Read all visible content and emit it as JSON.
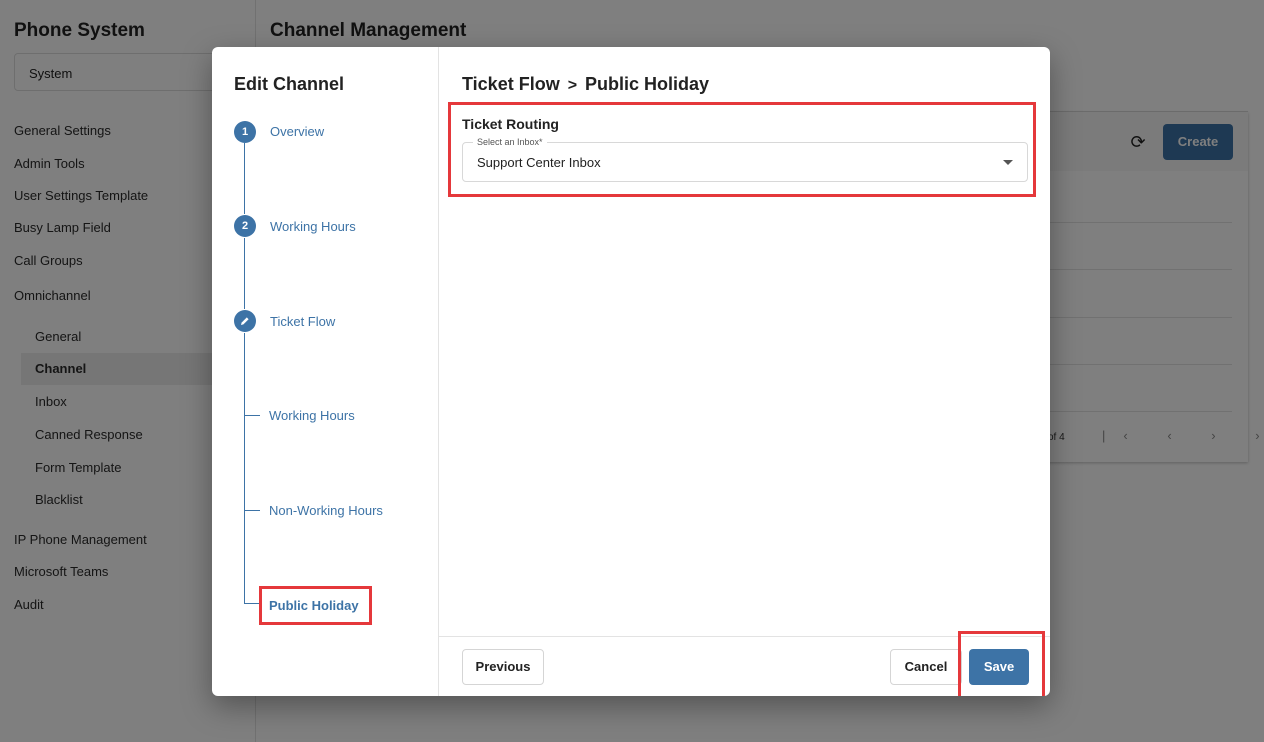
{
  "background": {
    "sidebar": {
      "title": "Phone System",
      "system_select": "System",
      "items": [
        {
          "label": "General Settings"
        },
        {
          "label": "Admin Tools"
        },
        {
          "label": "User Settings Template"
        },
        {
          "label": "Busy Lamp Field"
        },
        {
          "label": "Call Groups"
        },
        {
          "label": "Omnichannel"
        }
      ],
      "omnichannel_sub": [
        {
          "label": "General"
        },
        {
          "label": "Channel"
        },
        {
          "label": "Inbox"
        },
        {
          "label": "Canned Response"
        },
        {
          "label": "Form Template"
        },
        {
          "label": "Blacklist"
        }
      ],
      "items_after": [
        {
          "label": "IP Phone Management"
        },
        {
          "label": "Microsoft Teams"
        },
        {
          "label": "Audit"
        }
      ]
    },
    "main": {
      "title": "Channel Management",
      "create_label": "Create",
      "refresh_icon": "refresh-icon",
      "pager_text": "of 4",
      "pager_icons": "|‹ ‹ › ›|"
    }
  },
  "modal": {
    "title": "Edit Channel",
    "steps": [
      {
        "number": "1",
        "label": "Overview"
      },
      {
        "number": "2",
        "label": "Working Hours"
      },
      {
        "number": "",
        "icon": "pencil-icon",
        "label": "Ticket Flow"
      }
    ],
    "substeps": [
      {
        "label": "Working Hours"
      },
      {
        "label": "Non-Working Hours"
      },
      {
        "label": "Public Holiday"
      }
    ],
    "breadcrumb": {
      "parent": "Ticket Flow",
      "separator": ">",
      "current": "Public Holiday"
    },
    "section_title": "Ticket Routing",
    "inbox_field": {
      "label": "Select an Inbox*",
      "value": "Support Center Inbox"
    },
    "footer": {
      "previous_label": "Previous",
      "cancel_label": "Cancel",
      "save_label": "Save"
    }
  },
  "colors": {
    "accent": "#3d73a6",
    "highlight": "#e5383b"
  }
}
